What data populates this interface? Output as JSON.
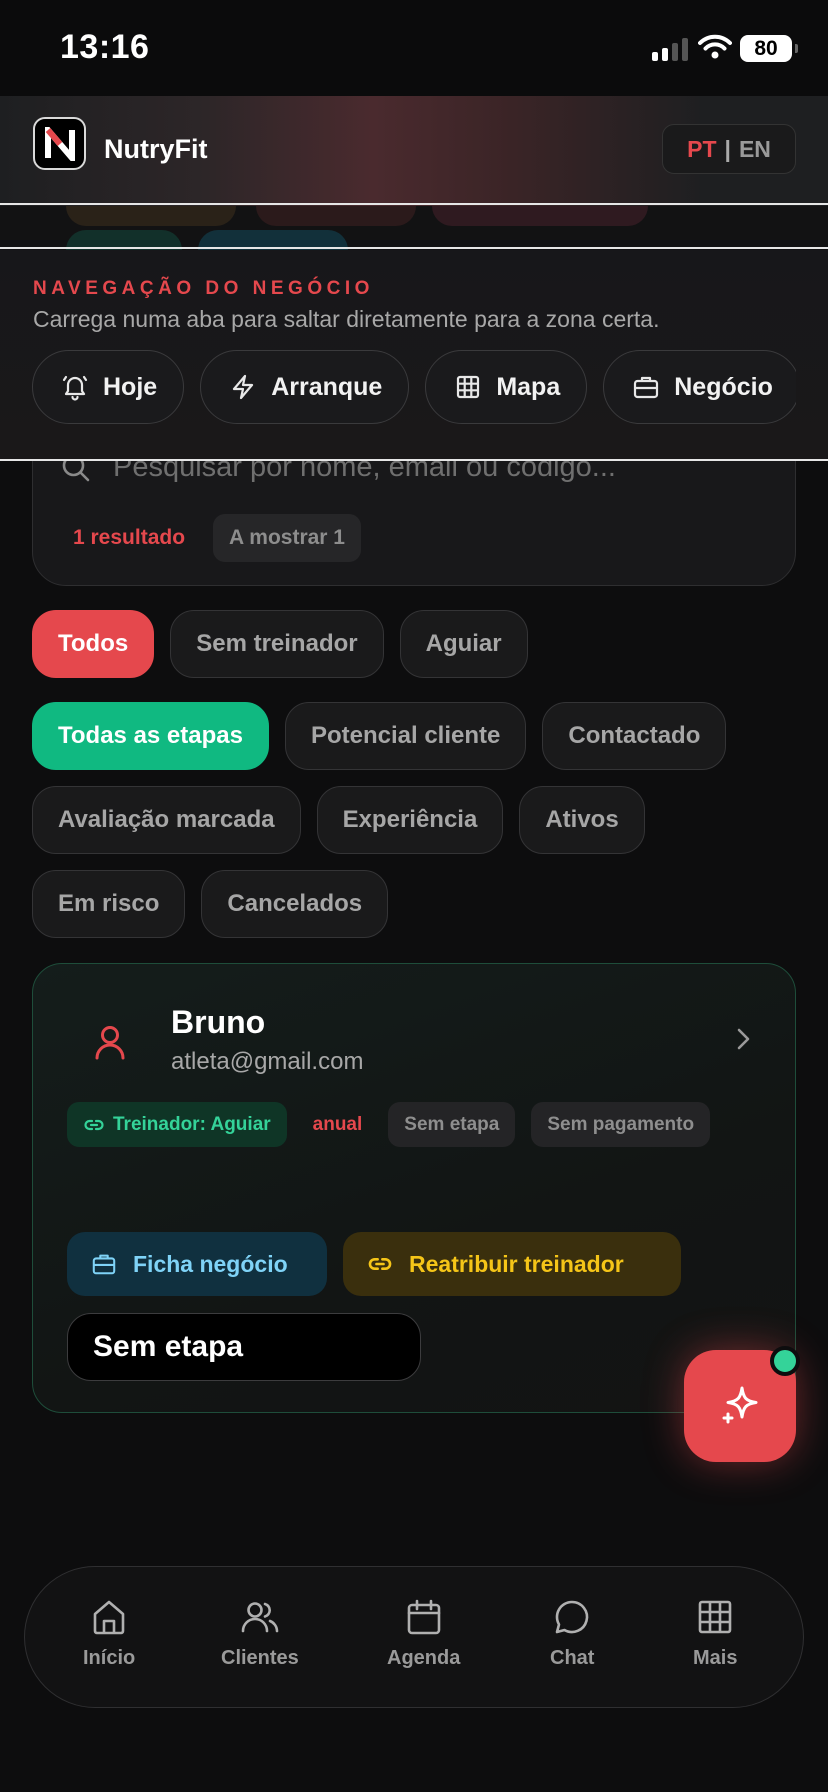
{
  "status_bar": {
    "time": "13:16",
    "battery": "80"
  },
  "header": {
    "app_name": "NutryFit",
    "logo_letter": "N",
    "lang_pt": "PT",
    "lang_sep": "|",
    "lang_en": "EN"
  },
  "business_nav": {
    "title": "NAVEGAÇÃO DO NEGÓCIO",
    "subtitle": "Carrega numa aba para saltar diretamente para a zona certa.",
    "tabs": [
      {
        "label": "Hoje",
        "icon": "bell-icon"
      },
      {
        "label": "Arranque",
        "icon": "bolt-icon"
      },
      {
        "label": "Mapa",
        "icon": "grid-icon"
      },
      {
        "label": "Negócio",
        "icon": "briefcase-icon"
      }
    ]
  },
  "search": {
    "placeholder": "Pesquisar por nome, email ou código...",
    "result_count": "1 resultado",
    "showing": "A mostrar 1"
  },
  "trainer_filters": [
    {
      "label": "Todos",
      "active": true
    },
    {
      "label": "Sem treinador",
      "active": false
    },
    {
      "label": "Aguiar",
      "active": false
    }
  ],
  "stage_filters": [
    {
      "label": "Todas as etapas",
      "active": true
    },
    {
      "label": "Potencial cliente",
      "active": false
    },
    {
      "label": "Contactado",
      "active": false
    },
    {
      "label": "Avaliação marcada",
      "active": false
    },
    {
      "label": "Experiência",
      "active": false
    },
    {
      "label": "Ativos",
      "active": false
    },
    {
      "label": "Em risco",
      "active": false
    },
    {
      "label": "Cancelados",
      "active": false
    }
  ],
  "client": {
    "name": "Bruno",
    "email": "atleta@gmail.com",
    "tags": {
      "trainer": "Treinador: Aguiar",
      "plan": "anual",
      "stage": "Sem etapa",
      "payment": "Sem pagamento"
    },
    "actions": {
      "business_file": "Ficha negócio",
      "reassign": "Reatribuir treinador"
    },
    "stage_select": "Sem etapa"
  },
  "bottom_nav": [
    {
      "label": "Início",
      "icon": "home-icon"
    },
    {
      "label": "Clientes",
      "icon": "users-icon"
    },
    {
      "label": "Agenda",
      "icon": "calendar-icon"
    },
    {
      "label": "Chat",
      "icon": "chat-icon"
    },
    {
      "label": "Mais",
      "icon": "grid-icon"
    }
  ],
  "colors": {
    "accent_red": "#e5484d",
    "accent_green": "#10b981",
    "background": "#0d0d0e"
  }
}
